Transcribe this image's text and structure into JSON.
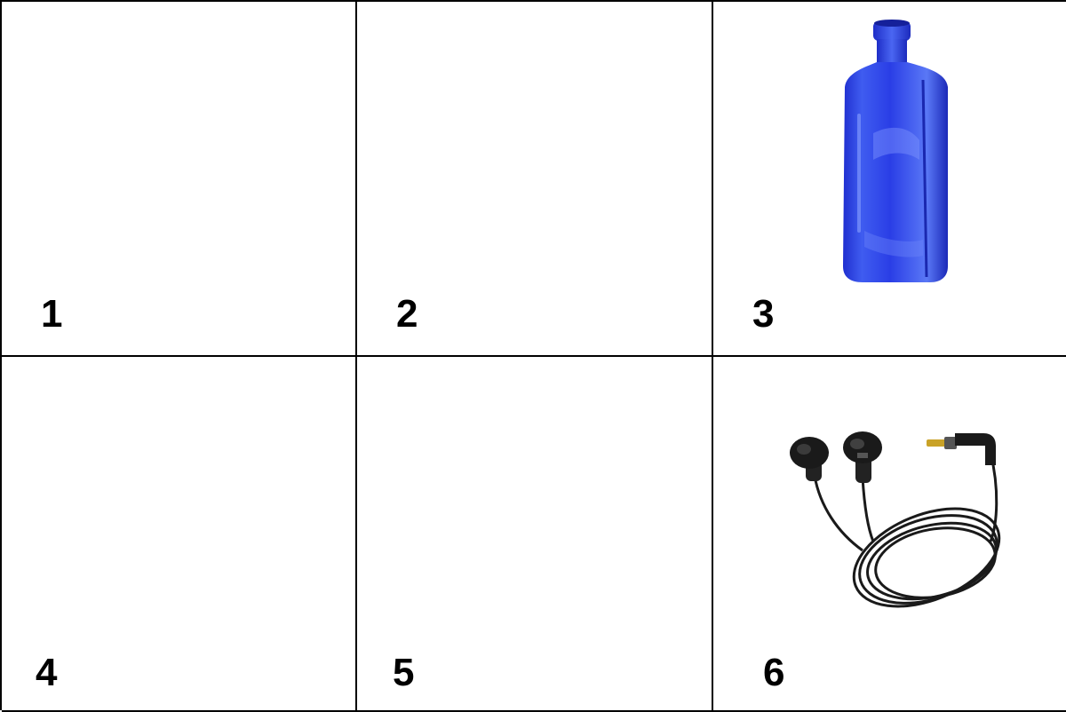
{
  "cells": [
    {
      "number": "1",
      "item": "empty"
    },
    {
      "number": "2",
      "item": "empty"
    },
    {
      "number": "3",
      "item": "blue-glass-bottle-icon"
    },
    {
      "number": "4",
      "item": "empty"
    },
    {
      "number": "5",
      "item": "empty"
    },
    {
      "number": "6",
      "item": "earphones-icon"
    }
  ],
  "colors": {
    "grid_line": "#000000",
    "bottle_blue": "#2b3fe0",
    "earphone_black": "#1a1a1a",
    "plug_gold": "#c9a227"
  }
}
